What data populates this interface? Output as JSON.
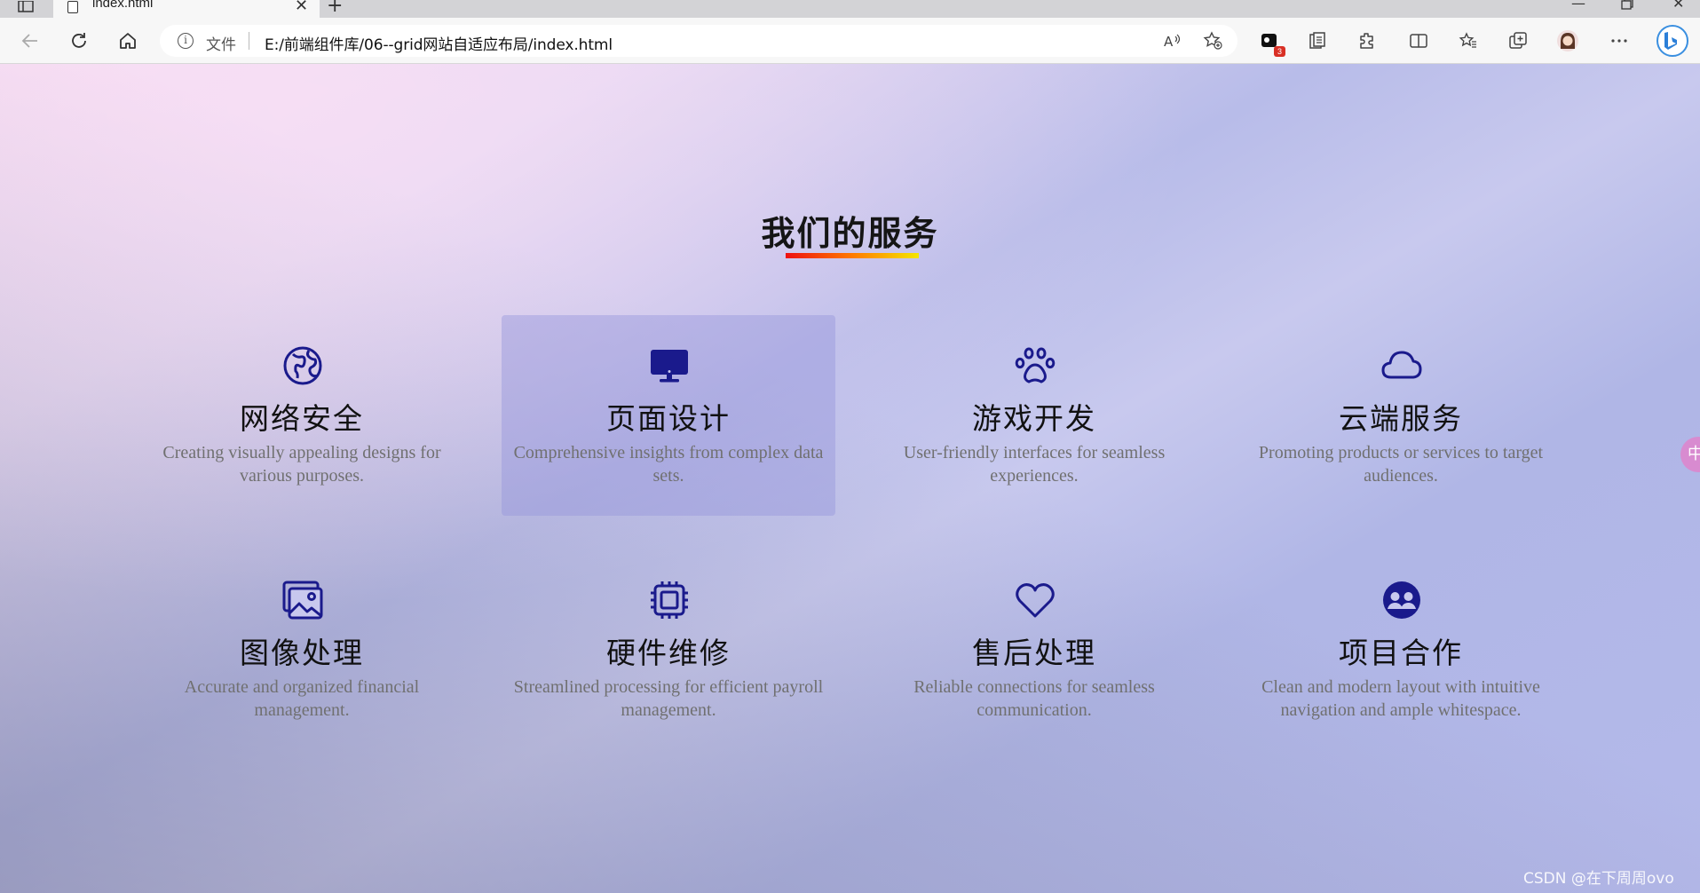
{
  "browser": {
    "tab_title": "index.html",
    "tab_close": "✕",
    "new_tab": "+",
    "address_label": "文件",
    "url": "E:/前端组件库/06--grid网站自适应布局/index.html",
    "extension_badge": "3"
  },
  "page": {
    "title": "我们的服务",
    "services": [
      {
        "name": "网络安全",
        "desc": "Creating visually appealing designs for various purposes.",
        "icon": "globe-icon"
      },
      {
        "name": "页面设计",
        "desc": "Comprehensive insights from complex data sets.",
        "icon": "desktop-icon"
      },
      {
        "name": "游戏开发",
        "desc": "User-friendly interfaces for seamless experiences.",
        "icon": "paw-icon"
      },
      {
        "name": "云端服务",
        "desc": "Promoting products or services to target audiences.",
        "icon": "cloud-icon"
      },
      {
        "name": "图像处理",
        "desc": "Accurate and organized financial management.",
        "icon": "images-icon"
      },
      {
        "name": "硬件维修",
        "desc": "Streamlined processing for efficient payroll management.",
        "icon": "cpu-icon"
      },
      {
        "name": "售后处理",
        "desc": "Reliable connections for seamless communication.",
        "icon": "heart-icon"
      },
      {
        "name": "项目合作",
        "desc": "Clean and modern layout with intuitive navigation and ample whitespace.",
        "icon": "people-icon"
      }
    ],
    "ime_indicator": "中",
    "watermark": "CSDN @在下周周ovo"
  },
  "colors": {
    "icon": "#1a1a8c",
    "title_underline": [
      "#ee1111",
      "#ff7a00",
      "#f5e600"
    ],
    "desc_text": "#707070"
  }
}
